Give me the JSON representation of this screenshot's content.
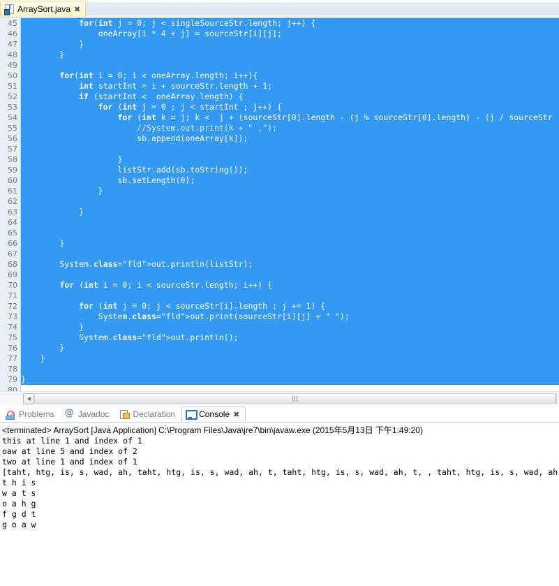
{
  "editor_tab": {
    "filename": "ArraySort.java",
    "icon": "java-file-icon",
    "close": "✖"
  },
  "code": {
    "first_line_number": 45,
    "last_line_number": 80,
    "selection_color": "#3399f3",
    "lines": [
      {
        "n": 45,
        "text": "            for(int j = 0; j < singleSourceStr.length; j++) {",
        "selected": true
      },
      {
        "n": 46,
        "text": "                oneArray[i * 4 + j] = sourceStr[i][j];",
        "selected": true
      },
      {
        "n": 47,
        "text": "            }",
        "selected": true
      },
      {
        "n": 48,
        "text": "        }",
        "selected": true
      },
      {
        "n": 49,
        "text": "",
        "selected": true
      },
      {
        "n": 50,
        "text": "        for(int i = 0; i < oneArray.length; i++){",
        "selected": true
      },
      {
        "n": 51,
        "text": "            int startInt = i + sourceStr.length + 1;",
        "selected": true
      },
      {
        "n": 52,
        "text": "            if (startInt <  oneArray.length) {",
        "selected": true
      },
      {
        "n": 53,
        "text": "                for (int j = 0 ; j < startInt ; j++) {",
        "selected": true
      },
      {
        "n": 54,
        "text": "                    for (int k = j; k <  j + (sourceStr[0].length - (j % sourceStr[0].length) - (j / sourceStr",
        "selected": true
      },
      {
        "n": 55,
        "text": "                        //System.out.print(k + \" ,\");",
        "selected": true
      },
      {
        "n": 56,
        "text": "                        sb.append(oneArray[k]);",
        "selected": true
      },
      {
        "n": 57,
        "text": "",
        "selected": true
      },
      {
        "n": 58,
        "text": "                    }",
        "selected": true
      },
      {
        "n": 59,
        "text": "                    listStr.add(sb.toString());",
        "selected": true
      },
      {
        "n": 60,
        "text": "                    sb.setLength(0);",
        "selected": true
      },
      {
        "n": 61,
        "text": "                }",
        "selected": true
      },
      {
        "n": 62,
        "text": "",
        "selected": true
      },
      {
        "n": 63,
        "text": "            }",
        "selected": true
      },
      {
        "n": 64,
        "text": "",
        "selected": true
      },
      {
        "n": 65,
        "text": "",
        "selected": true
      },
      {
        "n": 66,
        "text": "        }",
        "selected": true
      },
      {
        "n": 67,
        "text": "",
        "selected": true
      },
      {
        "n": 68,
        "text": "        System.out.println(listStr);",
        "selected": true
      },
      {
        "n": 69,
        "text": "",
        "selected": true
      },
      {
        "n": 70,
        "text": "        for (int i = 0; i < sourceStr.length; i++) {",
        "selected": true
      },
      {
        "n": 71,
        "text": "",
        "selected": true
      },
      {
        "n": 72,
        "text": "            for (int j = 0; j < sourceStr[i].length ; j += 1) {",
        "selected": true
      },
      {
        "n": 73,
        "text": "                System.out.print(sourceStr[i][j] + \" \");",
        "selected": true
      },
      {
        "n": 74,
        "text": "            }",
        "selected": true
      },
      {
        "n": 75,
        "text": "            System.out.println();",
        "selected": true
      },
      {
        "n": 76,
        "text": "        }",
        "selected": true
      },
      {
        "n": 77,
        "text": "    }",
        "selected": true
      },
      {
        "n": 78,
        "text": "",
        "selected": true
      },
      {
        "n": 79,
        "text": "}",
        "selected": true
      },
      {
        "n": 80,
        "text": "",
        "selected": false
      }
    ]
  },
  "hscroll": {
    "left_arrow": "◀",
    "grip": "scrollbar-grip"
  },
  "view_tabs": [
    {
      "label": "Problems",
      "icon": "problems-icon",
      "active": false
    },
    {
      "label": "Javadoc",
      "icon": "javadoc-icon",
      "active": false
    },
    {
      "label": "Declaration",
      "icon": "declaration-icon",
      "active": false
    },
    {
      "label": "Console",
      "icon": "console-icon",
      "active": true,
      "close": "✖"
    }
  ],
  "console": {
    "header": "<terminated> ArraySort [Java Application] C:\\Program Files\\Java\\jre7\\bin\\javaw.exe (2015年5月13日 下午1:49:20)",
    "lines": [
      "this at line 1 and index of 1",
      "oaw at line 5 and index of 2",
      "two at line 1 and index of 1",
      "[taht, htg, is, s, wad, ah, taht, htg, is, s, wad, ah, t, taht, htg, is, s, wad, ah, t, , taht, htg, is, s, wad, ah",
      "t h i s",
      "w a t s",
      "o a h g",
      "f g d t",
      "g o a w"
    ]
  }
}
